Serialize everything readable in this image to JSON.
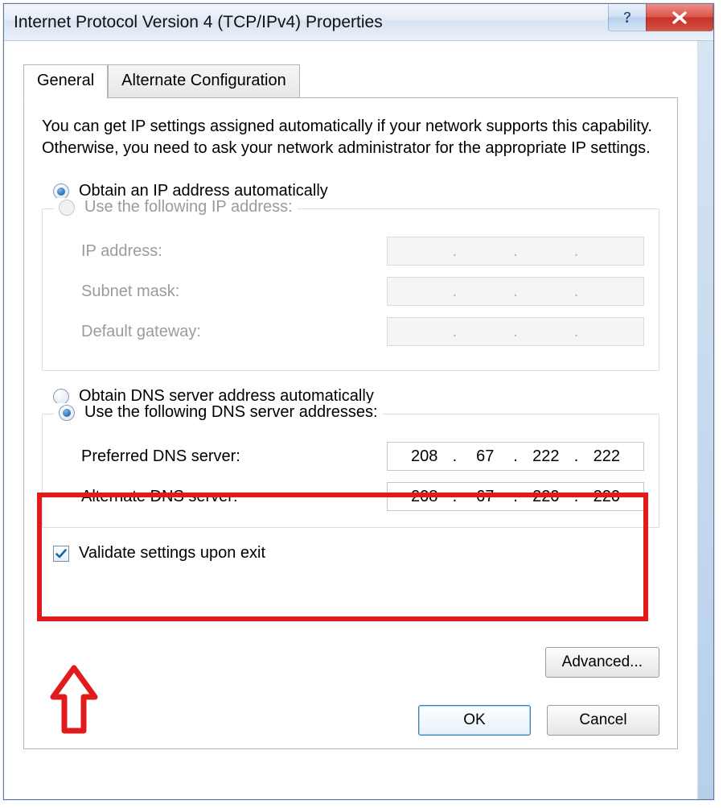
{
  "window": {
    "title": "Internet Protocol Version 4 (TCP/IPv4) Properties"
  },
  "tabs": {
    "general": "General",
    "alternate": "Alternate Configuration"
  },
  "intro": "You can get IP settings assigned automatically if your network supports this capability. Otherwise, you need to ask your network administrator for the appropriate IP settings.",
  "ip": {
    "auto_label": "Obtain an IP address automatically",
    "manual_label": "Use the following IP address:",
    "address_label": "IP address:",
    "subnet_label": "Subnet mask:",
    "gateway_label": "Default gateway:",
    "address": [
      "",
      "",
      "",
      ""
    ],
    "subnet": [
      "",
      "",
      "",
      ""
    ],
    "gateway": [
      "",
      "",
      "",
      ""
    ]
  },
  "dns": {
    "auto_label": "Obtain DNS server address automatically",
    "manual_label": "Use the following DNS server addresses:",
    "preferred_label": "Preferred DNS server:",
    "alternate_label": "Alternate DNS server:",
    "preferred": [
      "208",
      "67",
      "222",
      "222"
    ],
    "alternate": [
      "208",
      "67",
      "220",
      "220"
    ]
  },
  "validate_label": "Validate settings upon exit",
  "buttons": {
    "advanced": "Advanced...",
    "ok": "OK",
    "cancel": "Cancel"
  }
}
